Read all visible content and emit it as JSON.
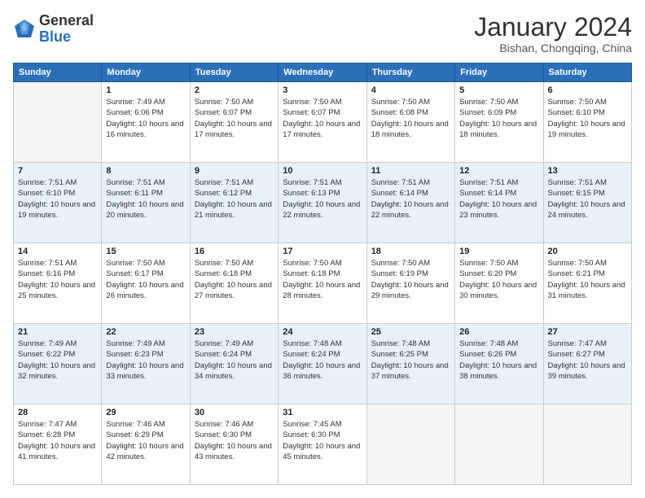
{
  "header": {
    "logo_general": "General",
    "logo_blue": "Blue",
    "month_title": "January 2024",
    "subtitle": "Bishan, Chongqing, China"
  },
  "weekdays": [
    "Sunday",
    "Monday",
    "Tuesday",
    "Wednesday",
    "Thursday",
    "Friday",
    "Saturday"
  ],
  "weeks": [
    [
      {
        "day": "",
        "sunrise": "",
        "sunset": "",
        "daylight": ""
      },
      {
        "day": "1",
        "sunrise": "Sunrise: 7:49 AM",
        "sunset": "Sunset: 6:06 PM",
        "daylight": "Daylight: 10 hours and 16 minutes."
      },
      {
        "day": "2",
        "sunrise": "Sunrise: 7:50 AM",
        "sunset": "Sunset: 6:07 PM",
        "daylight": "Daylight: 10 hours and 17 minutes."
      },
      {
        "day": "3",
        "sunrise": "Sunrise: 7:50 AM",
        "sunset": "Sunset: 6:07 PM",
        "daylight": "Daylight: 10 hours and 17 minutes."
      },
      {
        "day": "4",
        "sunrise": "Sunrise: 7:50 AM",
        "sunset": "Sunset: 6:08 PM",
        "daylight": "Daylight: 10 hours and 18 minutes."
      },
      {
        "day": "5",
        "sunrise": "Sunrise: 7:50 AM",
        "sunset": "Sunset: 6:09 PM",
        "daylight": "Daylight: 10 hours and 18 minutes."
      },
      {
        "day": "6",
        "sunrise": "Sunrise: 7:50 AM",
        "sunset": "Sunset: 6:10 PM",
        "daylight": "Daylight: 10 hours and 19 minutes."
      }
    ],
    [
      {
        "day": "7",
        "sunrise": "Sunrise: 7:51 AM",
        "sunset": "Sunset: 6:10 PM",
        "daylight": "Daylight: 10 hours and 19 minutes."
      },
      {
        "day": "8",
        "sunrise": "Sunrise: 7:51 AM",
        "sunset": "Sunset: 6:11 PM",
        "daylight": "Daylight: 10 hours and 20 minutes."
      },
      {
        "day": "9",
        "sunrise": "Sunrise: 7:51 AM",
        "sunset": "Sunset: 6:12 PM",
        "daylight": "Daylight: 10 hours and 21 minutes."
      },
      {
        "day": "10",
        "sunrise": "Sunrise: 7:51 AM",
        "sunset": "Sunset: 6:13 PM",
        "daylight": "Daylight: 10 hours and 22 minutes."
      },
      {
        "day": "11",
        "sunrise": "Sunrise: 7:51 AM",
        "sunset": "Sunset: 6:14 PM",
        "daylight": "Daylight: 10 hours and 22 minutes."
      },
      {
        "day": "12",
        "sunrise": "Sunrise: 7:51 AM",
        "sunset": "Sunset: 6:14 PM",
        "daylight": "Daylight: 10 hours and 23 minutes."
      },
      {
        "day": "13",
        "sunrise": "Sunrise: 7:51 AM",
        "sunset": "Sunset: 6:15 PM",
        "daylight": "Daylight: 10 hours and 24 minutes."
      }
    ],
    [
      {
        "day": "14",
        "sunrise": "Sunrise: 7:51 AM",
        "sunset": "Sunset: 6:16 PM",
        "daylight": "Daylight: 10 hours and 25 minutes."
      },
      {
        "day": "15",
        "sunrise": "Sunrise: 7:50 AM",
        "sunset": "Sunset: 6:17 PM",
        "daylight": "Daylight: 10 hours and 26 minutes."
      },
      {
        "day": "16",
        "sunrise": "Sunrise: 7:50 AM",
        "sunset": "Sunset: 6:18 PM",
        "daylight": "Daylight: 10 hours and 27 minutes."
      },
      {
        "day": "17",
        "sunrise": "Sunrise: 7:50 AM",
        "sunset": "Sunset: 6:18 PM",
        "daylight": "Daylight: 10 hours and 28 minutes."
      },
      {
        "day": "18",
        "sunrise": "Sunrise: 7:50 AM",
        "sunset": "Sunset: 6:19 PM",
        "daylight": "Daylight: 10 hours and 29 minutes."
      },
      {
        "day": "19",
        "sunrise": "Sunrise: 7:50 AM",
        "sunset": "Sunset: 6:20 PM",
        "daylight": "Daylight: 10 hours and 30 minutes."
      },
      {
        "day": "20",
        "sunrise": "Sunrise: 7:50 AM",
        "sunset": "Sunset: 6:21 PM",
        "daylight": "Daylight: 10 hours and 31 minutes."
      }
    ],
    [
      {
        "day": "21",
        "sunrise": "Sunrise: 7:49 AM",
        "sunset": "Sunset: 6:22 PM",
        "daylight": "Daylight: 10 hours and 32 minutes."
      },
      {
        "day": "22",
        "sunrise": "Sunrise: 7:49 AM",
        "sunset": "Sunset: 6:23 PM",
        "daylight": "Daylight: 10 hours and 33 minutes."
      },
      {
        "day": "23",
        "sunrise": "Sunrise: 7:49 AM",
        "sunset": "Sunset: 6:24 PM",
        "daylight": "Daylight: 10 hours and 34 minutes."
      },
      {
        "day": "24",
        "sunrise": "Sunrise: 7:48 AM",
        "sunset": "Sunset: 6:24 PM",
        "daylight": "Daylight: 10 hours and 36 minutes."
      },
      {
        "day": "25",
        "sunrise": "Sunrise: 7:48 AM",
        "sunset": "Sunset: 6:25 PM",
        "daylight": "Daylight: 10 hours and 37 minutes."
      },
      {
        "day": "26",
        "sunrise": "Sunrise: 7:48 AM",
        "sunset": "Sunset: 6:26 PM",
        "daylight": "Daylight: 10 hours and 38 minutes."
      },
      {
        "day": "27",
        "sunrise": "Sunrise: 7:47 AM",
        "sunset": "Sunset: 6:27 PM",
        "daylight": "Daylight: 10 hours and 39 minutes."
      }
    ],
    [
      {
        "day": "28",
        "sunrise": "Sunrise: 7:47 AM",
        "sunset": "Sunset: 6:28 PM",
        "daylight": "Daylight: 10 hours and 41 minutes."
      },
      {
        "day": "29",
        "sunrise": "Sunrise: 7:46 AM",
        "sunset": "Sunset: 6:29 PM",
        "daylight": "Daylight: 10 hours and 42 minutes."
      },
      {
        "day": "30",
        "sunrise": "Sunrise: 7:46 AM",
        "sunset": "Sunset: 6:30 PM",
        "daylight": "Daylight: 10 hours and 43 minutes."
      },
      {
        "day": "31",
        "sunrise": "Sunrise: 7:45 AM",
        "sunset": "Sunset: 6:30 PM",
        "daylight": "Daylight: 10 hours and 45 minutes."
      },
      {
        "day": "",
        "sunrise": "",
        "sunset": "",
        "daylight": ""
      },
      {
        "day": "",
        "sunrise": "",
        "sunset": "",
        "daylight": ""
      },
      {
        "day": "",
        "sunrise": "",
        "sunset": "",
        "daylight": ""
      }
    ]
  ]
}
